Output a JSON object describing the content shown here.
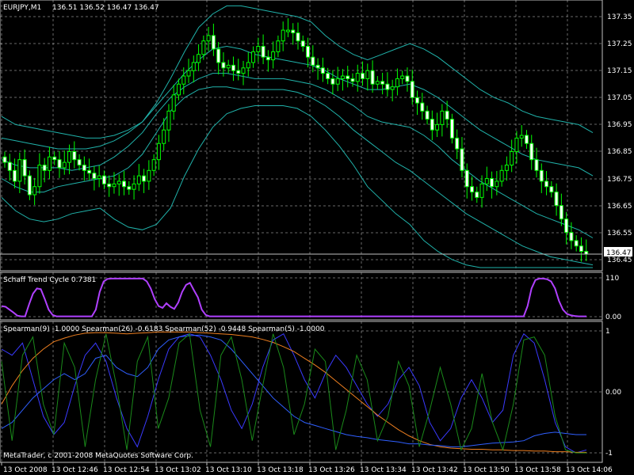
{
  "chart_window": {
    "symbol_header": "EURJPY,M1",
    "ohlc": "136.51 136.52 136.47 136.47",
    "copyright": "MetaQuotes Software Corp."
  },
  "colors": {
    "background": "#000000",
    "grid": "#c0c0c0",
    "candle": "#00ff00",
    "bands": "#20b2aa",
    "stc": "#b040ff",
    "spearman_9": "#3a3aff",
    "spearman_26": "#f08020",
    "spearman_52": "#2f5fff",
    "spearman_5": "#1a8a1a",
    "text": "#ffffff"
  },
  "chart_data": [
    {
      "type": "line",
      "pane": "price",
      "title": "EURJPY,M1",
      "ylim": [
        136.42,
        137.4
      ],
      "y_ticks": [
        "137.35",
        "137.25",
        "137.15",
        "137.05",
        "136.95",
        "136.85",
        "136.75",
        "136.65",
        "136.55",
        "136.45"
      ],
      "current_price_label": "136.47",
      "candles_close": [
        136.81,
        136.78,
        136.74,
        136.82,
        136.76,
        136.69,
        136.72,
        136.8,
        136.78,
        136.83,
        136.82,
        136.79,
        136.81,
        136.85,
        136.82,
        136.8,
        136.78,
        136.77,
        136.75,
        136.76,
        136.73,
        136.72,
        136.73,
        136.74,
        136.72,
        136.71,
        136.73,
        136.76,
        136.74,
        136.78,
        136.82,
        136.88,
        136.93,
        137.0,
        137.06,
        137.1,
        137.13,
        137.15,
        137.18,
        137.21,
        137.26,
        137.28,
        137.23,
        137.18,
        137.16,
        137.17,
        137.15,
        137.14,
        137.16,
        137.18,
        137.22,
        137.24,
        137.2,
        137.19,
        137.22,
        137.26,
        137.3,
        137.3,
        137.29,
        137.26,
        137.24,
        137.2,
        137.17,
        137.16,
        137.14,
        137.12,
        137.1,
        137.12,
        137.13,
        137.12,
        137.11,
        137.14,
        137.12,
        137.15,
        137.1,
        137.11,
        137.1,
        137.08,
        137.09,
        137.12,
        137.13,
        137.11,
        137.05,
        137.03,
        137.0,
        136.97,
        136.93,
        136.95,
        137.0,
        136.97,
        136.9,
        136.86,
        136.78,
        136.72,
        136.7,
        136.68,
        136.73,
        136.75,
        136.72,
        136.74,
        136.78,
        136.8,
        136.85,
        136.9,
        136.91,
        136.88,
        136.82,
        136.78,
        136.74,
        136.72,
        136.7,
        136.65,
        136.6,
        136.55,
        136.52,
        136.5,
        136.48,
        136.47
      ],
      "series": [
        {
          "name": "",
          "kind": "bollinger",
          "values": [
            136.98,
            136.95,
            136.94,
            136.93,
            136.92,
            136.91,
            136.9,
            136.9,
            136.91,
            136.93,
            136.96,
            137.03,
            137.12,
            137.22,
            137.31,
            137.36,
            137.39,
            137.39,
            137.38,
            137.37,
            137.36,
            137.35,
            137.33,
            137.28,
            137.24,
            137.21,
            137.19,
            137.21,
            137.23,
            137.25,
            137.23,
            137.2,
            137.16,
            137.12,
            137.08,
            137.05,
            137.03,
            137.0,
            136.98,
            136.97,
            136.96,
            136.95,
            136.92
          ]
        },
        {
          "name": "",
          "kind": "bollinger",
          "values": [
            136.9,
            136.89,
            136.88,
            136.87,
            136.86,
            136.86,
            136.86,
            136.87,
            136.89,
            136.92,
            136.96,
            137.02,
            137.08,
            137.14,
            137.19,
            137.23,
            137.24,
            137.23,
            137.21,
            137.2,
            137.19,
            137.18,
            137.17,
            137.15,
            137.12,
            137.1,
            137.08,
            137.08,
            137.09,
            137.1,
            137.08,
            137.05,
            137.01,
            136.97,
            136.93,
            136.9,
            136.87,
            136.84,
            136.82,
            136.81,
            136.8,
            136.79,
            136.76
          ]
        },
        {
          "name": "",
          "kind": "bollinger",
          "values": [
            136.82,
            136.8,
            136.79,
            136.79,
            136.79,
            136.78,
            136.79,
            136.8,
            136.83,
            136.87,
            136.92,
            136.99,
            137.05,
            137.09,
            137.12,
            137.14,
            137.14,
            137.13,
            137.12,
            137.12,
            137.12,
            137.11,
            137.1,
            137.08,
            137.05,
            137.02,
            136.98,
            136.96,
            136.95,
            136.94,
            136.91,
            136.87,
            136.82,
            136.78,
            136.74,
            136.71,
            136.68,
            136.65,
            136.62,
            136.6,
            136.58,
            136.56,
            136.53
          ]
        },
        {
          "name": "",
          "kind": "bollinger",
          "values": [
            136.75,
            136.72,
            136.7,
            136.7,
            136.72,
            136.73,
            136.74,
            136.75,
            136.76,
            136.79,
            136.84,
            136.92,
            137.0,
            137.05,
            137.08,
            137.09,
            137.09,
            137.08,
            137.08,
            137.08,
            137.08,
            137.07,
            137.05,
            137.02,
            136.98,
            136.93,
            136.89,
            136.85,
            136.81,
            136.78,
            136.74,
            136.7,
            136.66,
            136.62,
            136.59,
            136.56,
            136.53,
            136.5,
            136.48,
            136.46,
            136.45,
            136.44,
            136.43
          ]
        },
        {
          "name": "",
          "kind": "bollinger",
          "values": [
            136.68,
            136.63,
            136.6,
            136.59,
            136.6,
            136.62,
            136.63,
            136.64,
            136.6,
            136.57,
            136.56,
            136.58,
            136.64,
            136.76,
            136.86,
            136.94,
            136.99,
            137.01,
            137.02,
            137.02,
            137.02,
            137.01,
            136.98,
            136.93,
            136.87,
            136.8,
            136.72,
            136.67,
            136.62,
            136.58,
            136.52,
            136.48,
            136.45,
            136.43,
            136.42,
            136.42,
            136.42,
            136.42,
            136.42,
            136.42,
            136.42,
            136.42,
            136.42
          ]
        }
      ]
    },
    {
      "type": "line",
      "pane": "stc",
      "title": "Schaff Trend Cycle 0.7381",
      "ylim": [
        0,
        110
      ],
      "y_ticks": [
        "110",
        "0.00"
      ],
      "series": [
        {
          "name": "Schaff Trend Cycle 0.7381",
          "values": [
            30,
            28,
            20,
            12,
            3,
            1,
            1,
            35,
            65,
            80,
            78,
            50,
            20,
            5,
            1,
            1,
            1,
            1,
            1,
            1,
            1,
            1,
            1,
            1,
            20,
            70,
            100,
            107,
            108,
            108,
            108,
            108,
            108,
            108,
            108,
            108,
            108,
            100,
            80,
            50,
            30,
            25,
            38,
            28,
            22,
            40,
            70,
            90,
            96,
            75,
            55,
            20,
            5,
            1,
            1,
            1,
            1,
            1,
            1,
            1,
            1,
            1,
            1,
            1,
            1,
            1,
            1,
            1,
            1,
            1,
            1,
            1,
            1,
            1,
            1,
            1,
            1,
            1,
            1,
            1,
            1,
            1,
            1,
            1,
            1,
            1,
            1,
            1,
            1,
            1,
            1,
            1,
            1,
            1,
            1,
            1,
            1,
            1,
            1,
            1,
            1,
            1,
            1,
            1,
            1,
            1,
            1,
            1,
            1,
            1,
            1,
            1,
            1,
            1,
            1,
            1,
            1,
            1,
            1,
            1,
            1,
            1,
            1,
            1,
            1,
            1,
            1,
            1,
            1,
            1,
            1,
            1,
            1,
            1,
            30,
            80,
            104,
            108,
            108,
            106,
            100,
            80,
            45,
            20,
            8,
            4,
            2,
            1,
            1,
            1
          ]
        }
      ]
    },
    {
      "type": "line",
      "pane": "spearman",
      "title": "Spearman(9) -1.0000 Spearman(26) -0.6183 Spearman(52) -0.9448 Spearman(5) -1.0000",
      "ylim": [
        -1.05,
        1.05
      ],
      "y_ticks": [
        "1",
        "0.00",
        "-1"
      ],
      "series": [
        {
          "name": "Spearman(9)",
          "label": "Spearman(9) -1.0000",
          "values": [
            0.7,
            0.6,
            0.8,
            0.2,
            -0.4,
            -0.7,
            -0.5,
            0.1,
            0.6,
            0.8,
            0.5,
            -0.1,
            -0.6,
            -0.9,
            -0.4,
            0.2,
            0.7,
            0.9,
            0.95,
            0.9,
            0.6,
            0.2,
            -0.3,
            -0.6,
            -0.2,
            0.4,
            0.85,
            0.95,
            0.6,
            0.2,
            -0.1,
            0.3,
            0.6,
            0.4,
            0.1,
            -0.2,
            -0.4,
            -0.2,
            0.2,
            0.4,
            0.1,
            -0.5,
            -0.8,
            -0.6,
            -0.1,
            0.2,
            -0.1,
            -0.5,
            -0.3,
            0.6,
            0.95,
            0.8,
            0.2,
            -0.5,
            -0.9,
            -1.0,
            -0.95
          ]
        },
        {
          "name": "Spearman(26)",
          "label": "Spearman(26) -0.6183",
          "values": [
            -0.2,
            0.1,
            0.35,
            0.55,
            0.7,
            0.82,
            0.88,
            0.93,
            0.96,
            0.97,
            0.97,
            0.96,
            0.95,
            0.96,
            0.97,
            0.98,
            0.98,
            0.98,
            0.98,
            0.97,
            0.96,
            0.95,
            0.94,
            0.92,
            0.9,
            0.86,
            0.81,
            0.74,
            0.66,
            0.55,
            0.44,
            0.32,
            0.18,
            0.04,
            -0.1,
            -0.24,
            -0.38,
            -0.5,
            -0.62,
            -0.72,
            -0.8,
            -0.86,
            -0.9,
            -0.92,
            -0.93,
            -0.94,
            -0.94,
            -0.95,
            -0.95,
            -0.96,
            -0.96,
            -0.97,
            -0.97,
            -0.98,
            -0.98,
            -0.99,
            -0.99
          ]
        },
        {
          "name": "Spearman(52)",
          "label": "Spearman(52) -0.9448",
          "values": [
            -0.6,
            -0.5,
            -0.3,
            -0.1,
            0.05,
            0.2,
            0.3,
            0.2,
            0.3,
            0.55,
            0.6,
            0.4,
            0.3,
            0.25,
            0.4,
            0.7,
            0.85,
            0.9,
            0.92,
            0.93,
            0.9,
            0.85,
            0.7,
            0.5,
            0.3,
            0.1,
            -0.1,
            -0.25,
            -0.4,
            -0.5,
            -0.55,
            -0.6,
            -0.65,
            -0.7,
            -0.73,
            -0.75,
            -0.78,
            -0.8,
            -0.82,
            -0.85,
            -0.85,
            -0.87,
            -0.88,
            -0.9,
            -0.9,
            -0.88,
            -0.86,
            -0.84,
            -0.83,
            -0.82,
            -0.8,
            -0.72,
            -0.68,
            -0.66,
            -0.68,
            -0.7,
            -0.7
          ]
        },
        {
          "name": "Spearman(5)",
          "label": "Spearman(5) -1.0000",
          "values": [
            0.5,
            -0.8,
            0.6,
            0.9,
            -0.2,
            -0.7,
            0.8,
            0.4,
            -0.9,
            0.2,
            0.95,
            0.1,
            -0.95,
            0.5,
            0.9,
            -0.6,
            -0.1,
            0.8,
            0.95,
            -0.3,
            -0.9,
            0.6,
            0.9,
            0.2,
            -0.8,
            0.1,
            0.95,
            0.4,
            -0.7,
            -0.2,
            0.7,
            0.5,
            -0.95,
            -0.3,
            0.6,
            0.2,
            -0.8,
            -0.4,
            0.5,
            0.1,
            -0.9,
            -0.3,
            0.4,
            -0.2,
            -0.95,
            -0.6,
            0.3,
            -0.5,
            -0.95,
            -0.2,
            0.85,
            0.9,
            0.6,
            -0.4,
            -0.95,
            -1.0,
            -1.0
          ]
        }
      ]
    }
  ],
  "time_axis": [
    "13 Oct 2008",
    "13 Oct 12:46",
    "13 Oct 12:54",
    "13 Oct 13:02",
    "13 Oct 13:10",
    "13 Oct 13:18",
    "13 Oct 13:26",
    "13 Oct 13:34",
    "13 Oct 13:42",
    "13 Oct 13:50",
    "13 Oct 13:58",
    "13 Oct 14:06"
  ]
}
